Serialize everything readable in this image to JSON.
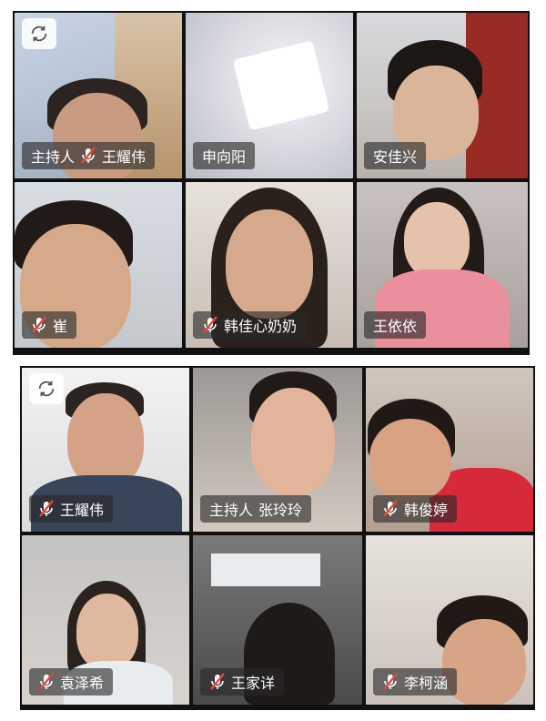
{
  "top_panel": {
    "tiles": [
      {
        "label": "主持人",
        "name": "王耀伟",
        "muted": true
      },
      {
        "label": "",
        "name": "申向阳",
        "muted": false
      },
      {
        "label": "",
        "name": "安佳兴",
        "muted": false
      },
      {
        "label": "",
        "name": "崔",
        "muted": true
      },
      {
        "label": "",
        "name": "韩佳心奶奶",
        "muted": true
      },
      {
        "label": "",
        "name": "王依依",
        "muted": false
      }
    ]
  },
  "bottom_panel": {
    "tiles": [
      {
        "label": "",
        "name": "王耀伟",
        "muted": true
      },
      {
        "label": "主持人",
        "name": "张玲玲",
        "muted": false
      },
      {
        "label": "",
        "name": "韩俊婷",
        "muted": true
      },
      {
        "label": "",
        "name": "袁泽希",
        "muted": true
      },
      {
        "label": "",
        "name": "王家详",
        "muted": true
      },
      {
        "label": "",
        "name": "李柯涵",
        "muted": true
      }
    ]
  },
  "icons": {
    "switch_camera": "camera-switch-icon",
    "mic_off": "mic-off-icon"
  },
  "colors": {
    "mic_slash": "#e8463a",
    "label_bg": "#3a3a3a"
  }
}
